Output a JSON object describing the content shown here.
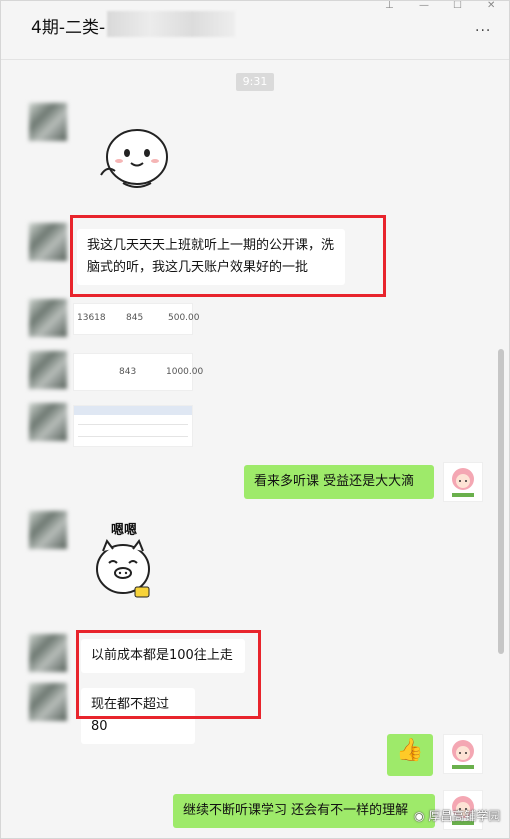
{
  "window": {
    "title": "4期-二类-",
    "more_glyph": "···",
    "pin_glyph": "⊥",
    "minimize_glyph": "—",
    "maximize_glyph": "☐",
    "close_glyph": "✕"
  },
  "chat": {
    "timestamp": "9:31",
    "messages": {
      "m1": "我这几天天天上班就听上一期的公开课，洗脑式的听，我这几天账户效果好的一批",
      "m2": "看来多听课 受益还是大大滴",
      "m3": "以前成本都是100往上走",
      "m4": "现在都不超过80",
      "m5": "继续不断听课学习 还会有不一样的理解"
    },
    "sticker_label": "嗯嗯",
    "thumb_emoji": "👍",
    "images": {
      "img1": [
        "13618",
        "845",
        "500.00"
      ],
      "img2": [
        "843",
        "1000.00"
      ]
    }
  },
  "watermark": "厚昌高铺学园",
  "colors": {
    "my_bubble": "#9eea6a",
    "highlight_box": "#e8242c"
  }
}
